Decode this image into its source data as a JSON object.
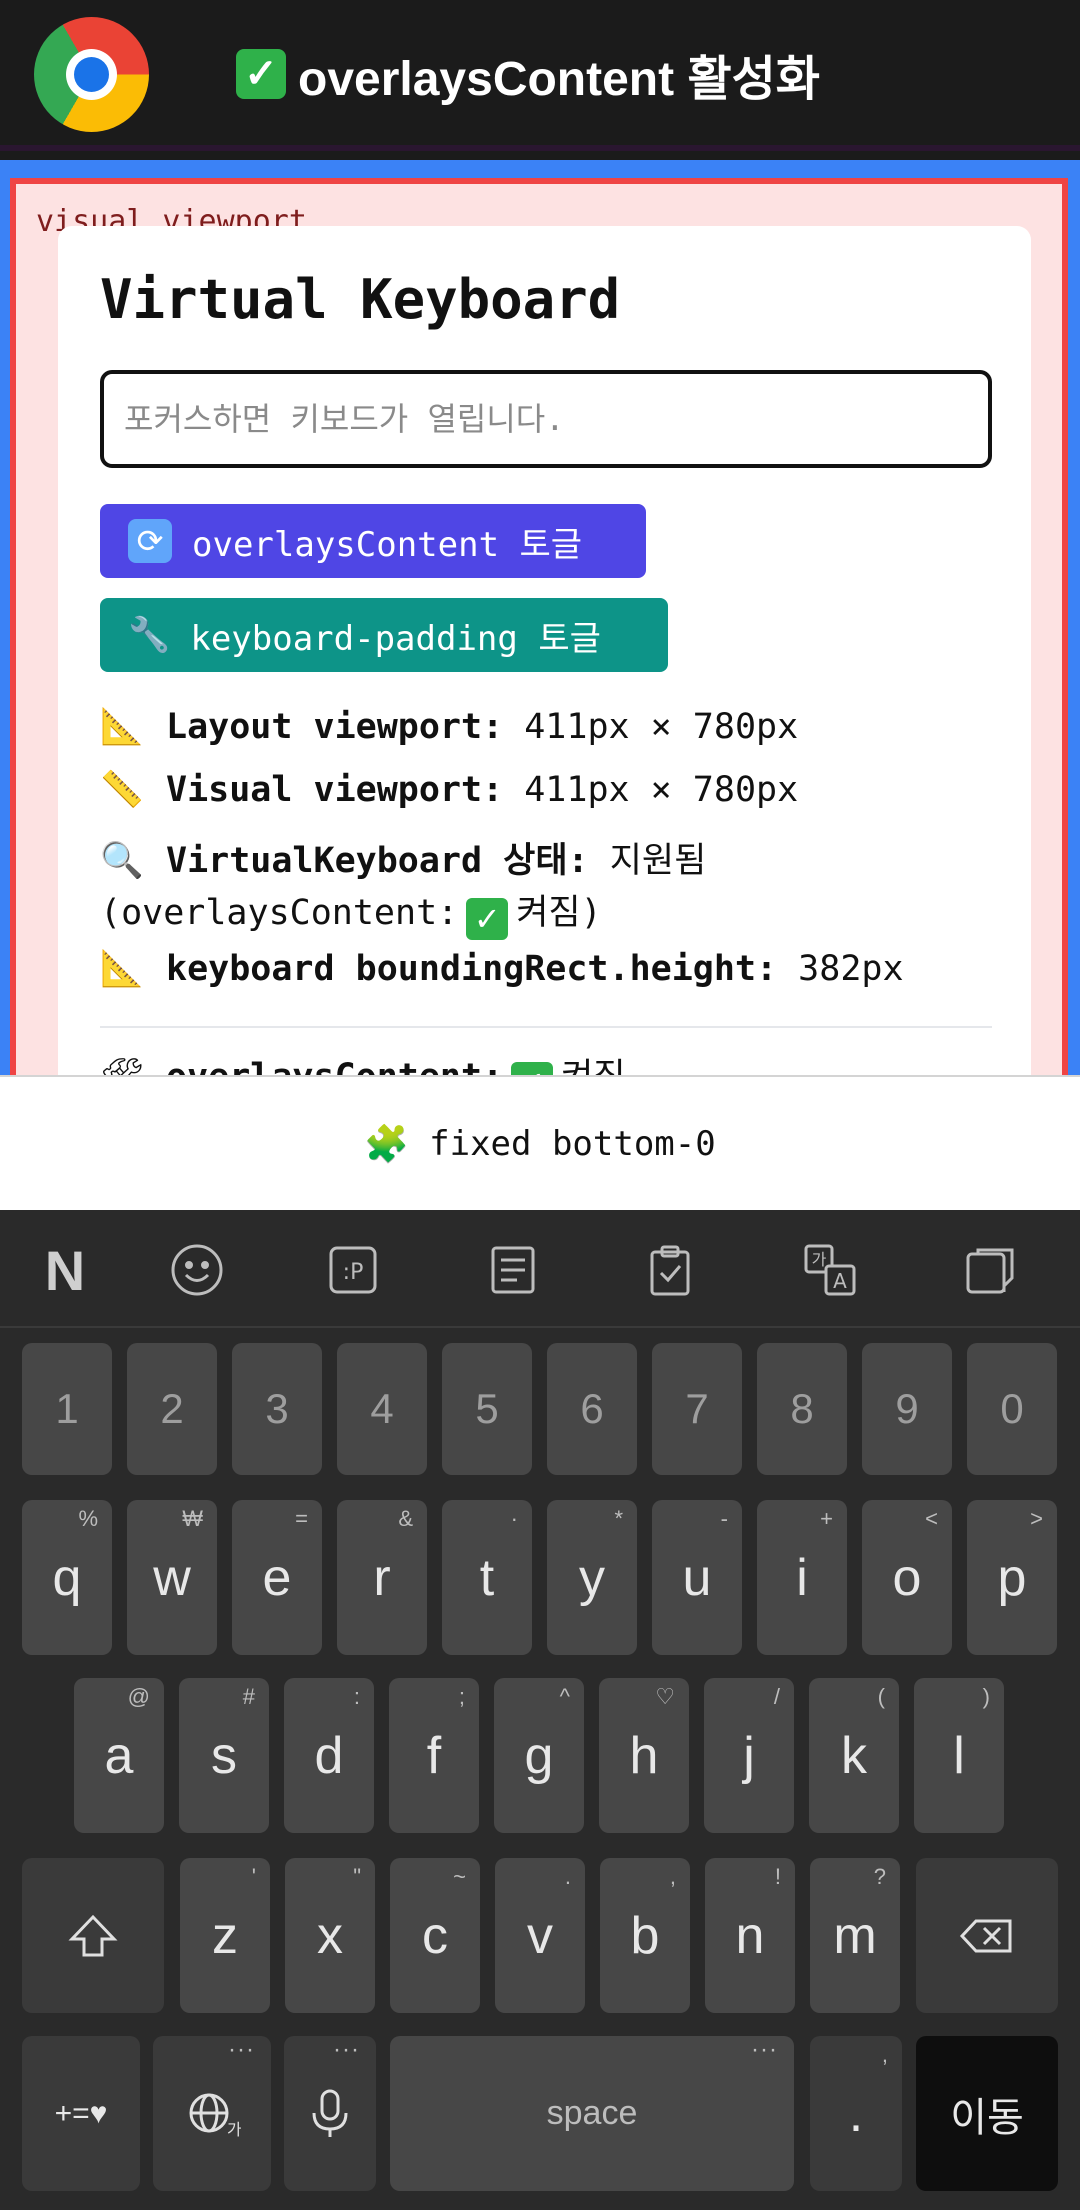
{
  "app": {
    "title": "overlaysContent 활성화",
    "title_check": "✓"
  },
  "page": {
    "visual_viewport_label": "visual viewport",
    "heading": "Virtual Keyboard",
    "input_placeholder": "포커스하면 키보드가 열립니다.",
    "btn_overlays": {
      "icon": "🔄",
      "label": "overlaysContent 토글"
    },
    "btn_padding": {
      "icon": "🔧",
      "label": "keyboard-padding 토글"
    },
    "info": {
      "layout": {
        "icon": "📐",
        "label": "Layout viewport:",
        "value": "411px × 780px"
      },
      "visual": {
        "icon": "📏",
        "label": "Visual viewport:",
        "value": "411px × 780px"
      },
      "vk_state": {
        "icon": "🔍",
        "label": "VirtualKeyboard 상태:",
        "value": "지원됨",
        "detail_prefix": "(overlaysContent:",
        "detail_check": "✓",
        "detail_suffix": "켜짐)"
      },
      "bounding": {
        "icon": "📐",
        "label": "keyboard boundingRect.height:",
        "value": "382px"
      },
      "overlays": {
        "icon": "🛠",
        "label": "overlaysContent:",
        "check": "✓",
        "value": "켜짐"
      }
    },
    "fixed_bar": {
      "icon": "🧩",
      "label": "fixed bottom-0"
    }
  },
  "keyboard": {
    "toolbar": {
      "n_logo": "N"
    },
    "numbers": [
      "1",
      "2",
      "3",
      "4",
      "5",
      "6",
      "7",
      "8",
      "9",
      "0"
    ],
    "row1": [
      {
        "k": "q",
        "s": "%"
      },
      {
        "k": "w",
        "s": "₩"
      },
      {
        "k": "e",
        "s": "="
      },
      {
        "k": "r",
        "s": "&"
      },
      {
        "k": "t",
        "s": "·"
      },
      {
        "k": "y",
        "s": "*"
      },
      {
        "k": "u",
        "s": "-"
      },
      {
        "k": "i",
        "s": "+"
      },
      {
        "k": "o",
        "s": "<"
      },
      {
        "k": "p",
        "s": ">"
      }
    ],
    "row2": [
      {
        "k": "a",
        "s": "@"
      },
      {
        "k": "s",
        "s": "#"
      },
      {
        "k": "d",
        "s": ":"
      },
      {
        "k": "f",
        "s": ";"
      },
      {
        "k": "g",
        "s": "^"
      },
      {
        "k": "h",
        "s": "♡"
      },
      {
        "k": "j",
        "s": "/"
      },
      {
        "k": "k",
        "s": "("
      },
      {
        "k": "l",
        "s": ")"
      }
    ],
    "row3": [
      {
        "k": "z",
        "s": "'"
      },
      {
        "k": "x",
        "s": "\""
      },
      {
        "k": "c",
        "s": "~"
      },
      {
        "k": "v",
        "s": "."
      },
      {
        "k": "b",
        "s": ","
      },
      {
        "k": "n",
        "s": "!"
      },
      {
        "k": "m",
        "s": "?"
      }
    ],
    "symbols_label": "+=♥",
    "space_label": "space",
    "period_label": ".",
    "period_sub": ",",
    "enter_label": "이동",
    "dots": "···"
  }
}
